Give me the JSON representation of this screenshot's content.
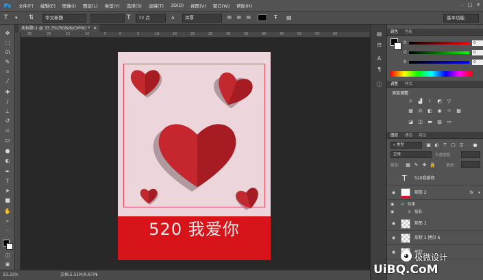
{
  "app": {
    "logo": "Ps"
  },
  "menu": [
    "文件(F)",
    "编辑(E)",
    "图像(I)",
    "图层(L)",
    "类型(Y)",
    "选择(S)",
    "滤镜(T)",
    "3D(D)",
    "视图(V)",
    "窗口(W)",
    "帮助(H)"
  ],
  "window_controls": {
    "minimize": "–",
    "restore": "□",
    "close": "✕"
  },
  "options": {
    "font_family": "华文新魏",
    "font_size": "72 点",
    "antialias_symbol": "a",
    "antialias": "浑厚",
    "workspace": "基本功能"
  },
  "document": {
    "tab_title": "未标题-1 @ 33.3%(RGB/8/CMYK) *",
    "headline": "520 我爱你"
  },
  "ruler_ticks": [
    "25",
    "20",
    "15",
    "10",
    "5",
    "0",
    "5",
    "10",
    "15",
    "20",
    "25",
    "30",
    "35",
    "40",
    "45",
    "50",
    "55",
    "60"
  ],
  "status": {
    "zoom": "33.33%",
    "doc_size": "文档:5.51M/9.87M"
  },
  "color_panel": {
    "tabs": [
      "颜色",
      "色板"
    ],
    "rows": [
      {
        "label": "R",
        "value": "0"
      },
      {
        "label": "G",
        "value": "0"
      },
      {
        "label": "B",
        "value": "0"
      }
    ]
  },
  "adjustments_panel": {
    "tabs": [
      "调整",
      "样式"
    ],
    "title": "添加调整"
  },
  "layers_panel": {
    "tabs": [
      "图层",
      "通道",
      "路径"
    ],
    "filter_kind": "类型",
    "blend_mode": "正常",
    "opacity_label": "不透明度:",
    "lock_label": "锁定:",
    "fill_label": "填充:",
    "layers": [
      {
        "name": "520我爱你",
        "kind": "text"
      },
      {
        "name": "矩形 2",
        "kind": "shape",
        "fx": "fx"
      },
      {
        "name": "矩形 1",
        "kind": "shape"
      },
      {
        "name": "形状 1 拷贝 6",
        "kind": "shape"
      },
      {
        "name": "形状",
        "kind": "shape"
      }
    ],
    "effects_label": "效果",
    "shadow_label": "投影"
  },
  "watermark": {
    "text": "极微设计",
    "brand": "UiBQ.CoM"
  }
}
